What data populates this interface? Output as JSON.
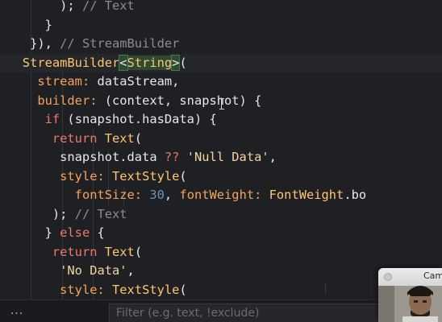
{
  "editor": {
    "lines": [
      [
        {
          "t": "        ); ",
          "c": "t-punc"
        },
        {
          "t": "// Text",
          "c": "t-comment"
        }
      ],
      [
        {
          "t": "      }",
          "c": "t-punc"
        }
      ],
      [
        {
          "t": "    }), ",
          "c": "t-punc"
        },
        {
          "t": "// StreamBuilder",
          "c": "t-comment"
        }
      ],
      [
        {
          "t": "   StreamBuilder",
          "c": "t-class"
        },
        {
          "t": "<",
          "c": "t-bracket-hl"
        },
        {
          "t": "String",
          "c": "t-type-hl"
        },
        {
          "t": ">",
          "c": "t-bracket-hl"
        },
        {
          "t": "(",
          "c": "t-punc"
        }
      ],
      [
        {
          "t": "     ",
          "c": "t-plain"
        },
        {
          "t": "stream: ",
          "c": "t-param"
        },
        {
          "t": "dataStream,",
          "c": "t-plain"
        }
      ],
      [
        {
          "t": "     ",
          "c": "t-plain"
        },
        {
          "t": "builder: ",
          "c": "t-param"
        },
        {
          "t": "(context, snapshot) {",
          "c": "t-plain"
        }
      ],
      [
        {
          "t": "      ",
          "c": "t-plain"
        },
        {
          "t": "if",
          "c": "t-kw"
        },
        {
          "t": " (snapshot.hasData) {",
          "c": "t-plain"
        }
      ],
      [
        {
          "t": "       ",
          "c": "t-plain"
        },
        {
          "t": "return ",
          "c": "t-kw"
        },
        {
          "t": "Text",
          "c": "t-class"
        },
        {
          "t": "(",
          "c": "t-punc"
        }
      ],
      [
        {
          "t": "        snapshot.data ",
          "c": "t-plain"
        },
        {
          "t": "??",
          "c": "t-op"
        },
        {
          "t": " ",
          "c": "t-plain"
        },
        {
          "t": "'Null Data'",
          "c": "t-str"
        },
        {
          "t": ",",
          "c": "t-punc"
        }
      ],
      [
        {
          "t": "        ",
          "c": "t-plain"
        },
        {
          "t": "style: ",
          "c": "t-param"
        },
        {
          "t": "TextStyle",
          "c": "t-class"
        },
        {
          "t": "(",
          "c": "t-punc"
        }
      ],
      [
        {
          "t": "          ",
          "c": "t-plain"
        },
        {
          "t": "fontSize: ",
          "c": "t-param"
        },
        {
          "t": "30",
          "c": "t-num"
        },
        {
          "t": ", ",
          "c": "t-punc"
        },
        {
          "t": "fontWeight: ",
          "c": "t-param"
        },
        {
          "t": "FontWeight",
          "c": "t-class"
        },
        {
          "t": ".bo",
          "c": "t-plain"
        }
      ],
      [
        {
          "t": "       ); ",
          "c": "t-punc"
        },
        {
          "t": "// Text",
          "c": "t-comment"
        }
      ],
      [
        {
          "t": "      } ",
          "c": "t-punc"
        },
        {
          "t": "else",
          "c": "t-kw"
        },
        {
          "t": " {",
          "c": "t-punc"
        }
      ],
      [
        {
          "t": "       ",
          "c": "t-plain"
        },
        {
          "t": "return ",
          "c": "t-kw"
        },
        {
          "t": "Text",
          "c": "t-class"
        },
        {
          "t": "(",
          "c": "t-punc"
        }
      ],
      [
        {
          "t": "        ",
          "c": "t-plain"
        },
        {
          "t": "'No Data'",
          "c": "t-str"
        },
        {
          "t": ",",
          "c": "t-punc"
        }
      ],
      [
        {
          "t": "        ",
          "c": "t-plain"
        },
        {
          "t": "style: ",
          "c": "t-param"
        },
        {
          "t": "TextStyle",
          "c": "t-class"
        },
        {
          "t": "(",
          "c": "t-punc"
        }
      ]
    ],
    "active_line": 3
  },
  "bottom_bar": {
    "more_label": "...",
    "filter_placeholder": "Filter (e.g. text, !exclude)"
  },
  "camera": {
    "title": "Camera"
  }
}
